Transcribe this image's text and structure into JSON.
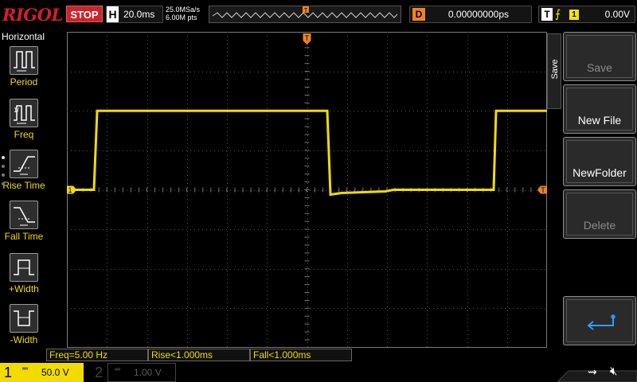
{
  "topbar": {
    "logo": "RIGOL",
    "run_state": "STOP",
    "horizontal_letter": "H",
    "timebase": "20.0ms",
    "sample_rate": "25.0MSa/s",
    "memory_depth": "6.00M pts",
    "delay_letter": "D",
    "delay": "0.00000000ps",
    "trigger_letter": "T",
    "trigger_source": "1",
    "trigger_level": "0.00V",
    "colors": {
      "stop": "#c9262b",
      "logo": "#d51f26",
      "trigger": "#f0821e"
    }
  },
  "left_menu": {
    "title": "Horizontal",
    "items": [
      {
        "label": "Period",
        "icon": "period-icon"
      },
      {
        "label": "Freq",
        "icon": "frequency-icon"
      },
      {
        "label": "Rise Time",
        "icon": "rise-time-icon"
      },
      {
        "label": "Fall Time",
        "icon": "fall-time-icon"
      },
      {
        "label": "+Width",
        "icon": "positive-width-icon"
      },
      {
        "label": "-Width",
        "icon": "negative-width-icon"
      }
    ]
  },
  "right_menu": {
    "tab": "Save",
    "buttons": [
      {
        "label": "Save",
        "enabled": false
      },
      {
        "label": "New File",
        "enabled": true
      },
      {
        "label": "NewFolder",
        "enabled": true
      },
      {
        "label": "Delete",
        "enabled": false
      },
      {
        "label": "",
        "icon": "return-arrow-icon",
        "enabled": true
      }
    ]
  },
  "measurements": [
    "Freq=5.00 Hz",
    "Rise<1.000ms",
    "Fall<1.000ms"
  ],
  "channels": {
    "ch1": {
      "number": "1",
      "coupling": "═",
      "scale": "50.0 V",
      "marker": "1",
      "color": "#f2dc00"
    },
    "ch2": {
      "number": "2",
      "coupling": "═",
      "scale": "1.00 V"
    }
  },
  "status_icons": [
    "usb-icon",
    "speaker-muted-icon"
  ],
  "waveform": {
    "color": "#f2dc00",
    "low_level_div": 0.0,
    "high_level_div": 2.0,
    "divisions_h": 12,
    "divisions_v": 8
  }
}
